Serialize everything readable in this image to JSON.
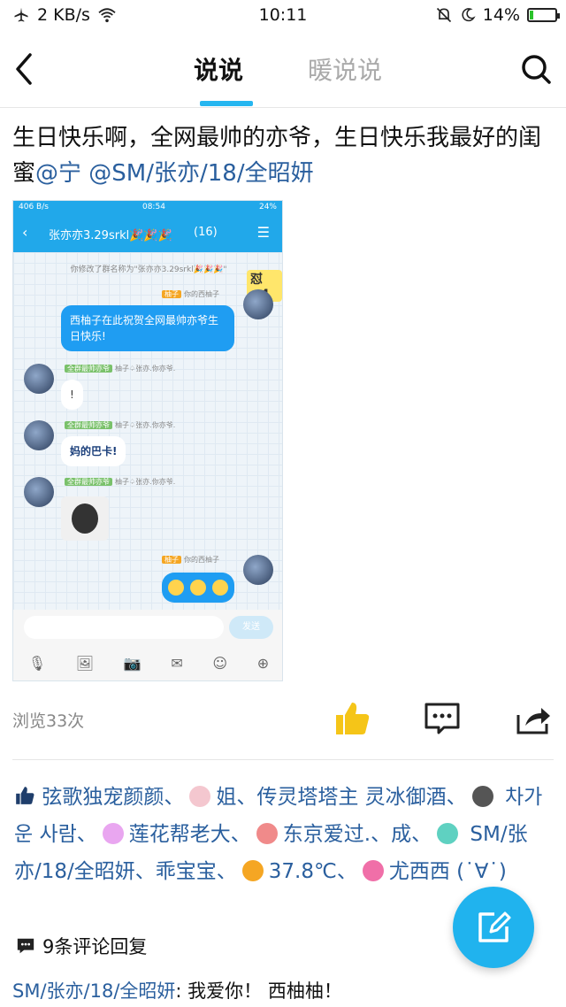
{
  "status_bar": {
    "network_speed": "2 KB/s",
    "time": "10:11",
    "battery": "14%",
    "battery_level": 0.14
  },
  "header": {
    "tab_active": "说说",
    "tab_inactive": "暖说说"
  },
  "post": {
    "text": "生日快乐啊，全网最帅的亦爷，生日快乐我最好的闺蜜",
    "mention1": "@宁",
    "mention2": "@SM/张亦/18/全昭妍"
  },
  "screenshot": {
    "status_left": "406 B/s",
    "status_time": "08:54",
    "status_right": "24%",
    "chat_title": "张亦亦3.29srkl🎉🎉🎉",
    "chat_count": "(16)",
    "system_note": "你修改了群名称为\"张亦亦3.29srkl🎉🎉🎉\"",
    "sticker_tag": "怼×4",
    "me_badge": "柚子",
    "me_name": "你的西柚子",
    "me_message": "西柚子在此祝贺全网最帅亦爷生日快乐!",
    "other_badge": "全群最帅亦爷",
    "other_name": "柚子♤张亦.你亦爷.",
    "reply1": "!",
    "reply2": "妈的巴卡!",
    "send_label": "发送"
  },
  "actions": {
    "views": "浏览33次"
  },
  "likes": {
    "names": [
      "弦歌独宠颜颜",
      "姐",
      "传灵塔塔主 灵冰御酒",
      "차가운 사람",
      "莲花帮老大",
      "东京爱过.",
      "成",
      "SM/张亦/18/全昭妍",
      "乖宝宝",
      "37.8℃",
      "尤西西 (˙∀˙)"
    ],
    "sep": "、"
  },
  "comments": {
    "count_label": "9条评论回复",
    "first_author": "SM/张亦/18/全昭妍",
    "first_text": ": 我爱你！ 西柚柚！"
  },
  "colors": {
    "accent": "#26b6f0",
    "link": "#2a5f9e",
    "like": "#f5c518"
  }
}
